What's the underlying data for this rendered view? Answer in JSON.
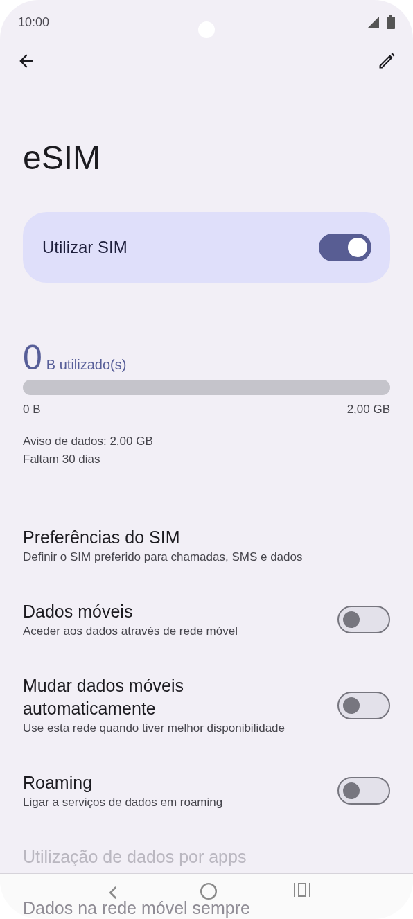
{
  "status_bar": {
    "time": "10:00"
  },
  "title": "eSIM",
  "sim_card": {
    "label": "Utilizar SIM",
    "on": true
  },
  "usage": {
    "amount": "0",
    "unit": "B utilizado(s)",
    "level": 0,
    "min_label": "0 B",
    "max_label": "2,00 GB",
    "warning": "Aviso de dados: 2,00 GB",
    "remaining": "Faltam 30 dias"
  },
  "settings": [
    {
      "kind": "link",
      "title": "Preferências do SIM",
      "subtitle": "Definir o SIM preferido para chamadas, SMS e dados",
      "disabled": false
    },
    {
      "kind": "toggle",
      "title": "Dados móveis",
      "subtitle": "Aceder aos dados através de rede móvel",
      "on": false
    },
    {
      "kind": "toggle",
      "title": "Mudar dados móveis automaticamente",
      "subtitle": "Use esta rede quando tiver melhor disponibilidade",
      "on": false
    },
    {
      "kind": "toggle",
      "title": "Roaming",
      "subtitle": "Ligar a serviços de dados em roaming",
      "on": false
    },
    {
      "kind": "link",
      "title": "Utilização de dados por apps",
      "disabled": true
    },
    {
      "kind": "link",
      "title": "Dados na rede móvel sempre",
      "disabled": true
    }
  ]
}
